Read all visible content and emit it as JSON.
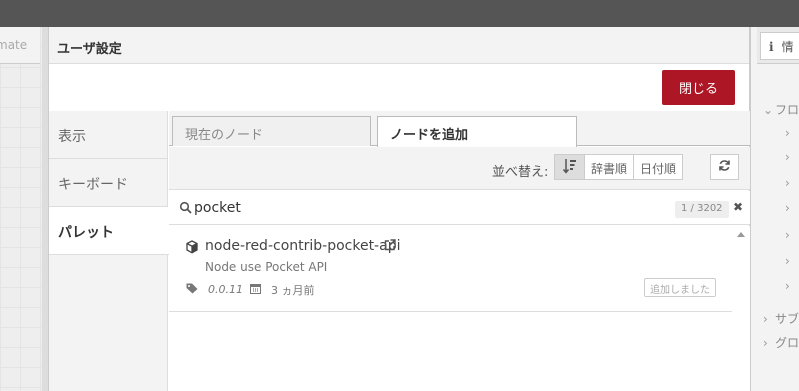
{
  "background": {
    "left_tab_label": "mate",
    "right_tab_icon": "info-icon",
    "right_tab_label": "情",
    "tree": {
      "flow_label": "フロ",
      "subflow_label": "サブ",
      "global_label": "グロ"
    }
  },
  "dialog": {
    "title": "ユーザ設定",
    "close_label": "閉じる",
    "sidebar": {
      "items": [
        {
          "label": "表示"
        },
        {
          "label": "キーボード"
        },
        {
          "label": "パレット"
        }
      ]
    },
    "tabs": [
      {
        "label": "現在のノード"
      },
      {
        "label": "ノードを追加"
      }
    ],
    "sort": {
      "label": "並べ替え:",
      "options": [
        "辞書順",
        "日付順"
      ]
    },
    "search": {
      "value": "pocket",
      "count": "1 / 3202",
      "clear": "✖"
    },
    "results": [
      {
        "name": "node-red-contrib-pocket-api",
        "description": "Node use Pocket API",
        "version": "0.0.11",
        "updated": "3 ヵ月前",
        "status_label": "追加しました"
      }
    ]
  },
  "colors": {
    "close_button": "#AD1625",
    "topbar": "#555555"
  }
}
